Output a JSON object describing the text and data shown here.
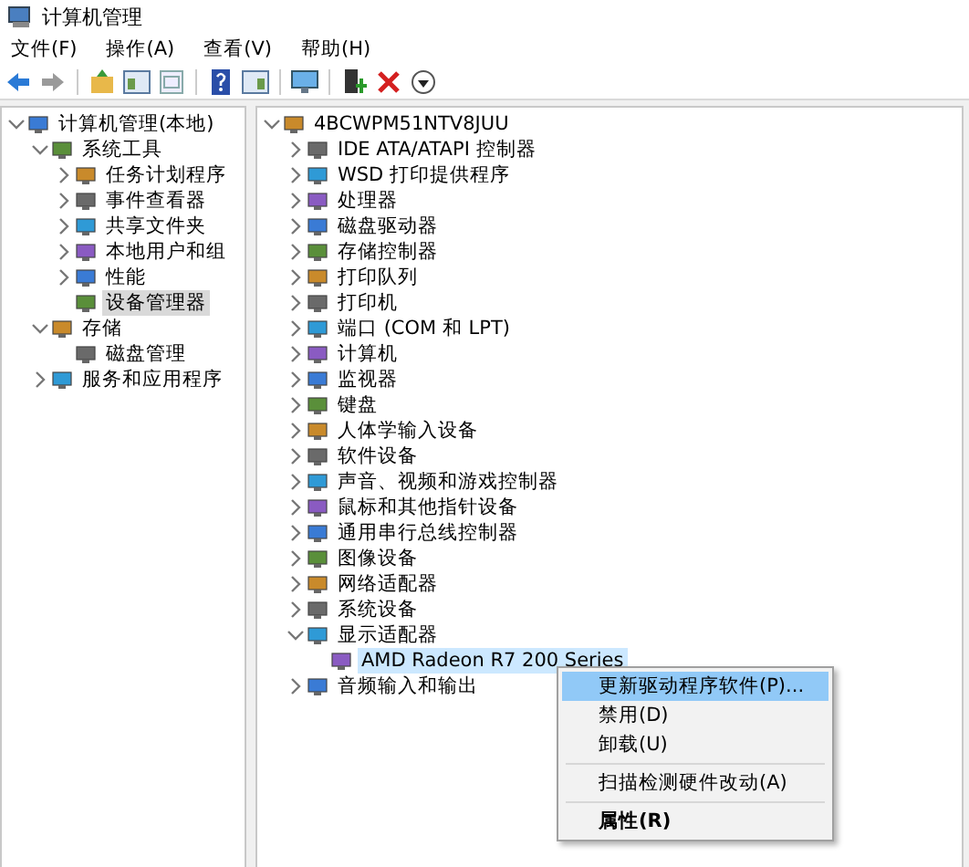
{
  "window": {
    "title": "计算机管理"
  },
  "menu": [
    "文件(F)",
    "操作(A)",
    "查看(V)",
    "帮助(H)"
  ],
  "left_tree": [
    {
      "label": "计算机管理(本地)",
      "expanded": true,
      "selected": false,
      "children": [
        {
          "label": "系统工具",
          "expanded": true,
          "selected": false,
          "children": [
            {
              "label": "任务计划程序",
              "expanded": false,
              "selected": false
            },
            {
              "label": "事件查看器",
              "expanded": false,
              "selected": false
            },
            {
              "label": "共享文件夹",
              "expanded": false,
              "selected": false
            },
            {
              "label": "本地用户和组",
              "expanded": false,
              "selected": false
            },
            {
              "label": "性能",
              "expanded": false,
              "selected": false
            },
            {
              "label": "设备管理器",
              "selected": true
            }
          ]
        },
        {
          "label": "存储",
          "expanded": true,
          "selected": false,
          "children": [
            {
              "label": "磁盘管理",
              "selected": false
            }
          ]
        },
        {
          "label": "服务和应用程序",
          "expanded": false,
          "selected": false
        }
      ]
    }
  ],
  "device_tree": [
    {
      "label": "4BCWPM51NTV8JUU",
      "expanded": true,
      "selected": false,
      "children": [
        {
          "label": "IDE ATA/ATAPI 控制器",
          "expanded": false,
          "selected": false
        },
        {
          "label": "WSD 打印提供程序",
          "expanded": false,
          "selected": false
        },
        {
          "label": "处理器",
          "expanded": false,
          "selected": false
        },
        {
          "label": "磁盘驱动器",
          "expanded": false,
          "selected": false
        },
        {
          "label": "存储控制器",
          "expanded": false,
          "selected": false
        },
        {
          "label": "打印队列",
          "expanded": false,
          "selected": false
        },
        {
          "label": "打印机",
          "expanded": false,
          "selected": false
        },
        {
          "label": "端口 (COM 和 LPT)",
          "expanded": false,
          "selected": false
        },
        {
          "label": "计算机",
          "expanded": false,
          "selected": false
        },
        {
          "label": "监视器",
          "expanded": false,
          "selected": false
        },
        {
          "label": "键盘",
          "expanded": false,
          "selected": false
        },
        {
          "label": "人体学输入设备",
          "expanded": false,
          "selected": false
        },
        {
          "label": "软件设备",
          "expanded": false,
          "selected": false
        },
        {
          "label": "声音、视频和游戏控制器",
          "expanded": false,
          "selected": false
        },
        {
          "label": "鼠标和其他指针设备",
          "expanded": false,
          "selected": false
        },
        {
          "label": "通用串行总线控制器",
          "expanded": false,
          "selected": false
        },
        {
          "label": "图像设备",
          "expanded": false,
          "selected": false
        },
        {
          "label": "网络适配器",
          "expanded": false,
          "selected": false
        },
        {
          "label": "系统设备",
          "expanded": false,
          "selected": false
        },
        {
          "label": "显示适配器",
          "expanded": true,
          "selected": false,
          "children": [
            {
              "label": "AMD Radeon R7 200 Series",
              "selected": true
            }
          ]
        },
        {
          "label": "音频输入和输出",
          "expanded": false,
          "selected": false
        }
      ]
    }
  ],
  "context_menu": [
    {
      "label": "更新驱动程序软件(P)...",
      "selected": true,
      "separator_before": false,
      "bold": false
    },
    {
      "label": "禁用(D)",
      "selected": false,
      "separator_before": false,
      "bold": false
    },
    {
      "label": "卸载(U)",
      "selected": false,
      "separator_before": false,
      "bold": false
    },
    {
      "label": "扫描检测硬件改动(A)",
      "selected": false,
      "separator_before": true,
      "bold": false
    },
    {
      "label": "属性(R)",
      "selected": false,
      "separator_before": true,
      "bold": true
    }
  ]
}
